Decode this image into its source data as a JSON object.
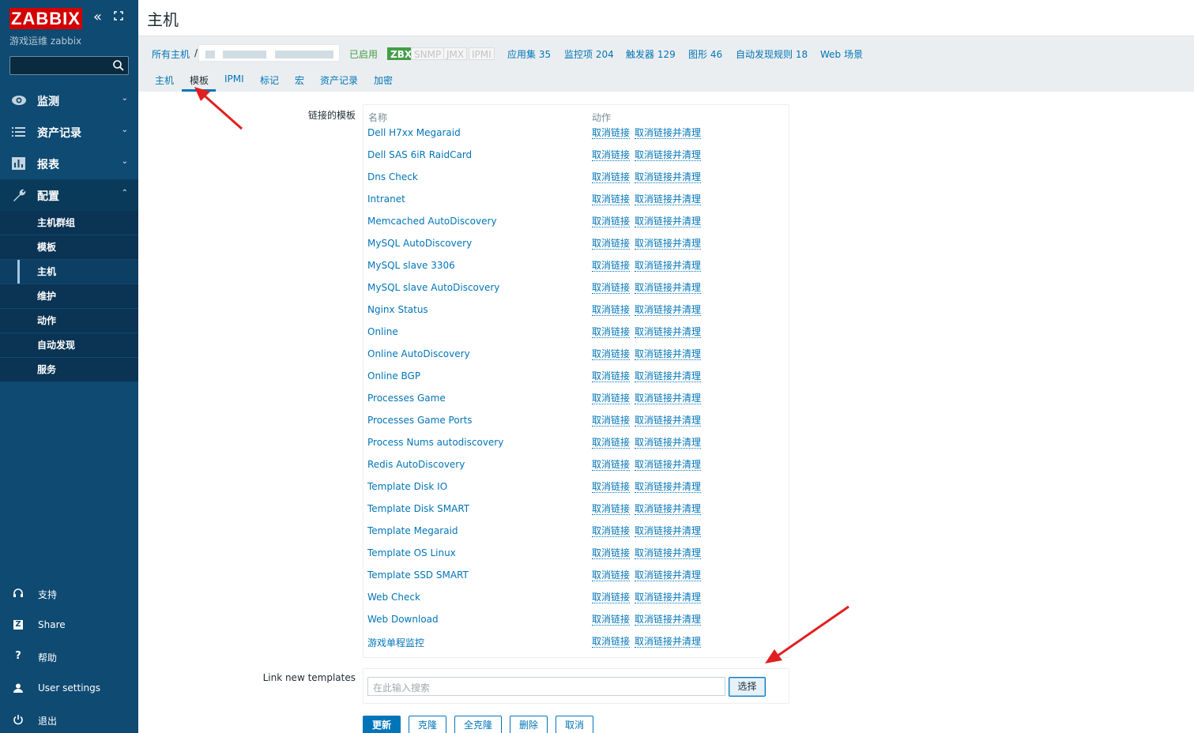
{
  "sidebar": {
    "logo": "ZABBIX",
    "server_name": "游戏运维 zabbix",
    "search_value": "",
    "sections": [
      {
        "label": "监测",
        "icon": "eye-icon"
      },
      {
        "label": "资产记录",
        "icon": "list-icon"
      },
      {
        "label": "报表",
        "icon": "bar-chart-icon"
      },
      {
        "label": "配置",
        "icon": "wrench-icon"
      }
    ],
    "config_items": [
      "主机群组",
      "模板",
      "主机",
      "维护",
      "动作",
      "自动发现",
      "服务"
    ],
    "selected_config_item": "主机",
    "bottom": [
      {
        "label": "支持",
        "icon": "headset-icon"
      },
      {
        "label": "Share",
        "icon": "share-icon"
      },
      {
        "label": "帮助",
        "icon": "help-icon"
      },
      {
        "label": "User settings",
        "icon": "user-icon"
      },
      {
        "label": "退出",
        "icon": "power-icon"
      }
    ]
  },
  "header": {
    "title": "主机"
  },
  "hostbar": {
    "all_hosts": "所有主机",
    "separator": "/",
    "status": "已启用",
    "badges": [
      "ZBX",
      "SNMP",
      "JMX",
      "IPMI"
    ],
    "applications": "应用集 35",
    "items": "监控项 204",
    "triggers": "触发器 129",
    "graphs": "图形 46",
    "discovery": "自动发现规则 18",
    "web": "Web 场景"
  },
  "tabs": [
    "主机",
    "模板",
    "IPMI",
    "标记",
    "宏",
    "资产记录",
    "加密"
  ],
  "active_tab": "模板",
  "linked_templates": {
    "label": "链接的模板",
    "col_name": "名称",
    "col_action": "动作",
    "unlink": "取消链接",
    "unlink_clear": "取消链接并清理",
    "rows": [
      "Dell H7xx Megaraid",
      "Dell SAS 6iR RaidCard",
      "Dns Check",
      "Intranet",
      "Memcached AutoDiscovery",
      "MySQL AutoDiscovery",
      "MySQL slave 3306",
      "MySQL slave AutoDiscovery",
      "Nginx Status",
      "Online",
      "Online AutoDiscovery",
      "Online BGP",
      "Processes Game",
      "Processes Game Ports",
      "Process Nums autodiscovery",
      "Redis AutoDiscovery",
      "Template Disk IO",
      "Template Disk SMART",
      "Template Megaraid",
      "Template OS Linux",
      "Template SSD SMART",
      "Web Check",
      "Web Download",
      "游戏单程监控"
    ]
  },
  "link_new": {
    "label": "Link new templates",
    "placeholder": "在此输入搜索",
    "select_label": "选择"
  },
  "buttons": {
    "update": "更新",
    "clone": "克隆",
    "full_clone": "全克隆",
    "delete": "删除",
    "cancel": "取消"
  },
  "colors": {
    "sidebar": "#0e4a72",
    "link": "#0275b8",
    "enabled": "#429e47",
    "logo": "#d40000",
    "annotation_arrow": "#e02020"
  }
}
